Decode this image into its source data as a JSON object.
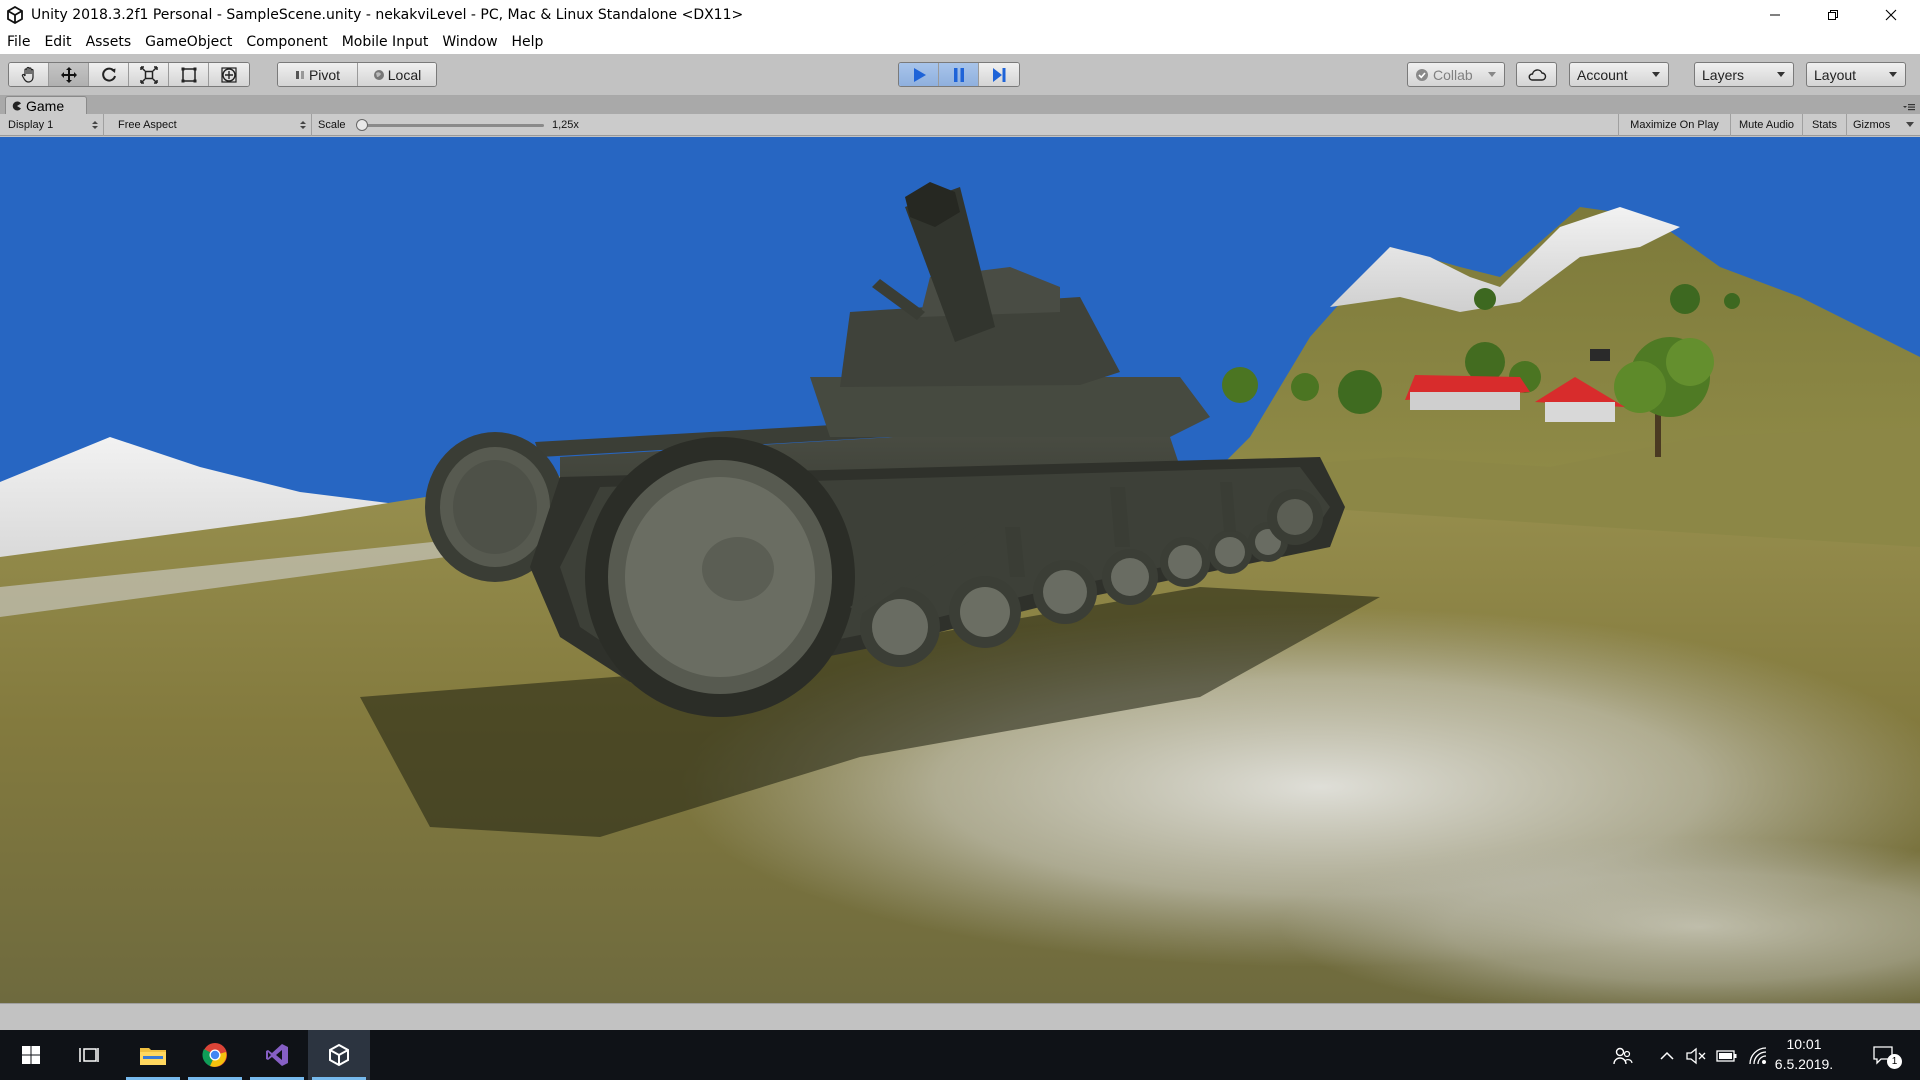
{
  "window": {
    "title": "Unity 2018.3.2f1 Personal - SampleScene.unity - nekakviLevel - PC, Mac & Linux Standalone <DX11>",
    "icon": "unity-logo-icon",
    "controls": [
      "minimize-icon",
      "restore-icon",
      "close-icon"
    ]
  },
  "menu": {
    "items": [
      "File",
      "Edit",
      "Assets",
      "GameObject",
      "Component",
      "Mobile Input",
      "Window",
      "Help"
    ]
  },
  "toolbar": {
    "tools": [
      "hand-tool-icon",
      "move-tool-icon",
      "rotate-tool-icon",
      "scale-tool-icon",
      "rect-tool-icon",
      "transform-tool-icon"
    ],
    "active_tool": "move-tool-icon",
    "pivot_label": "Pivot",
    "local_label": "Local",
    "playback": {
      "play_active": true,
      "pause_active": true
    },
    "collab_label": "Collab",
    "account_label": "Account",
    "layers_label": "Layers",
    "layout_label": "Layout"
  },
  "game_panel": {
    "tab_label": "Game",
    "display_label": "Display 1",
    "aspect_label": "Free Aspect",
    "scale_label": "Scale",
    "scale_value": "1,25x",
    "maximize_label": "Maximize On Play",
    "mute_label": "Mute Audio",
    "stats_label": "Stats",
    "gizmos_label": "Gizmos"
  },
  "taskbar": {
    "apps": [
      "windows-start-icon",
      "task-view-icon",
      "file-explorer-icon",
      "chrome-icon",
      "visual-studio-icon",
      "unity-icon"
    ],
    "time": "10:01",
    "date": "6.5.2019.",
    "notification_count": "1"
  },
  "colors": {
    "sky": "#2766c2",
    "sea": "#20b8d8",
    "terrain": "#8a8442",
    "tank": "#3a3d35",
    "roof": "#d82c2c",
    "play_active": "#1e63d8",
    "taskbar": "#0f1217"
  }
}
